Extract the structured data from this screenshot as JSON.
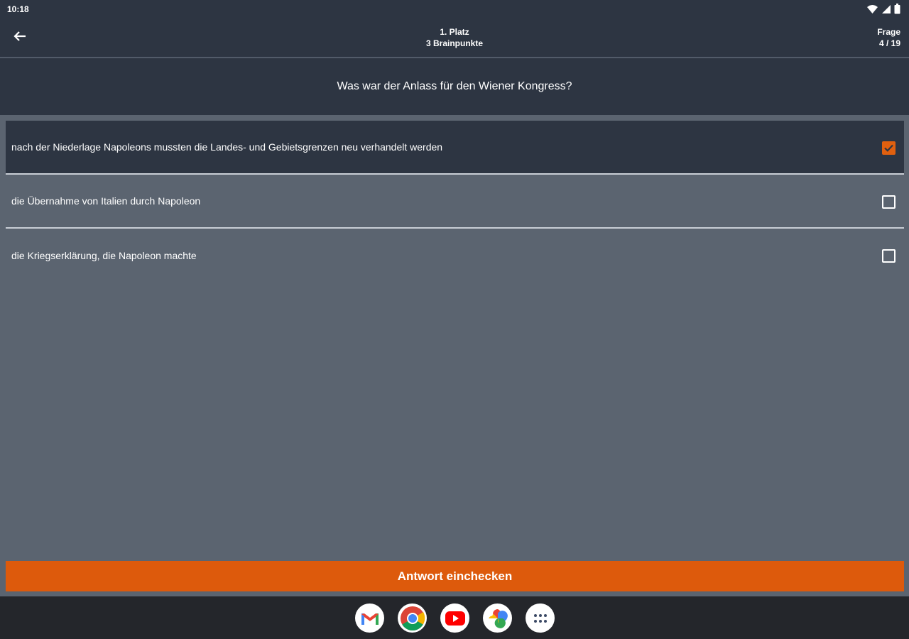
{
  "status_bar": {
    "time": "10:18"
  },
  "app_bar": {
    "rank": "1. Platz",
    "points": "3 Brainpunkte",
    "question_label": "Frage",
    "question_counter": "4 / 19"
  },
  "question": {
    "text": "Was war der Anlass für den Wiener Kongress?"
  },
  "answers": [
    {
      "text": "nach der Niederlage Napoleons mussten die Landes- und Gebietsgrenzen neu verhandelt werden",
      "checked": true
    },
    {
      "text": "die Übernahme von Italien durch Napoleon",
      "checked": false
    },
    {
      "text": "die Kriegserklärung, die Napoleon machte",
      "checked": false
    }
  ],
  "submit": {
    "label": "Antwort einchecken"
  },
  "dock": {
    "apps": [
      "gmail-icon",
      "chrome-icon",
      "youtube-icon",
      "photos-icon",
      "app-drawer-icon"
    ]
  },
  "colors": {
    "accent": "#dd5a0c",
    "header": "#2d3542",
    "background": "#5b6470"
  }
}
